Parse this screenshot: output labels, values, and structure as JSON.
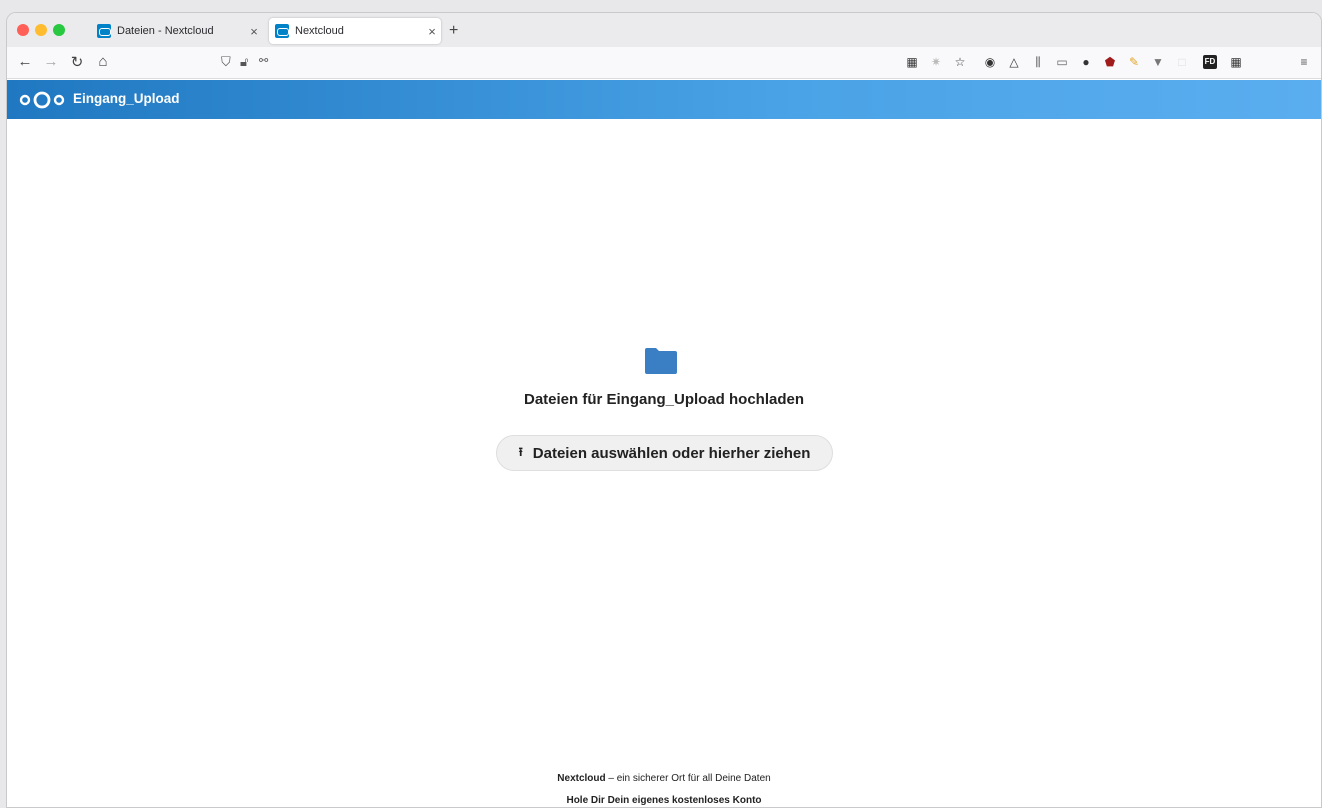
{
  "browser": {
    "tabs": [
      {
        "title": "Dateien - Nextcloud",
        "active": false
      },
      {
        "title": "Nextcloud",
        "active": true
      }
    ],
    "new_tab": "+",
    "close": "×"
  },
  "toolbar_icons": [
    "grid-icon",
    "bug-icon",
    "star-icon",
    "onepassword-icon",
    "cloud-icon",
    "library-icon",
    "sidebar-icon",
    "s-icon",
    "ublock-icon",
    "pen-icon",
    "v-icon",
    "blank-icon",
    "fd-icon",
    "grid2-icon",
    "menu-icon"
  ],
  "header": {
    "title": "Eingang_Upload",
    "color": "#1f78c1"
  },
  "main": {
    "heading": "Dateien für Eingang_Upload hochladen",
    "upload_button": "Dateien auswählen oder hierher ziehen",
    "folder_color": "#3a7ec4"
  },
  "footer": {
    "brand": "Nextcloud",
    "tagline": " – ein sicherer Ort für all Deine Daten",
    "cta": "Hole Dir Dein eigenes kostenloses Konto"
  }
}
